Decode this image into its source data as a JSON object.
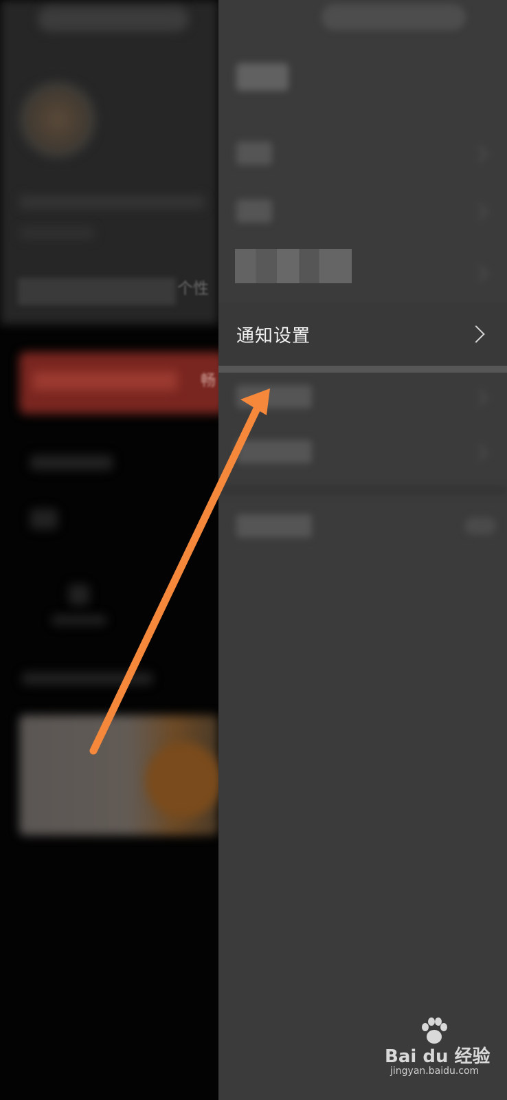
{
  "left_page": {
    "signature_suffix": "个性",
    "card_suffix": "畅"
  },
  "settings": {
    "notification_row": {
      "label": "通知设置",
      "chevron_icon": "chevron-right-icon"
    }
  },
  "annotation": {
    "arrow_color": "#F5883B"
  },
  "watermark": {
    "logo_text": "Bai du 经验",
    "url": "jingyan.baidu.com"
  }
}
